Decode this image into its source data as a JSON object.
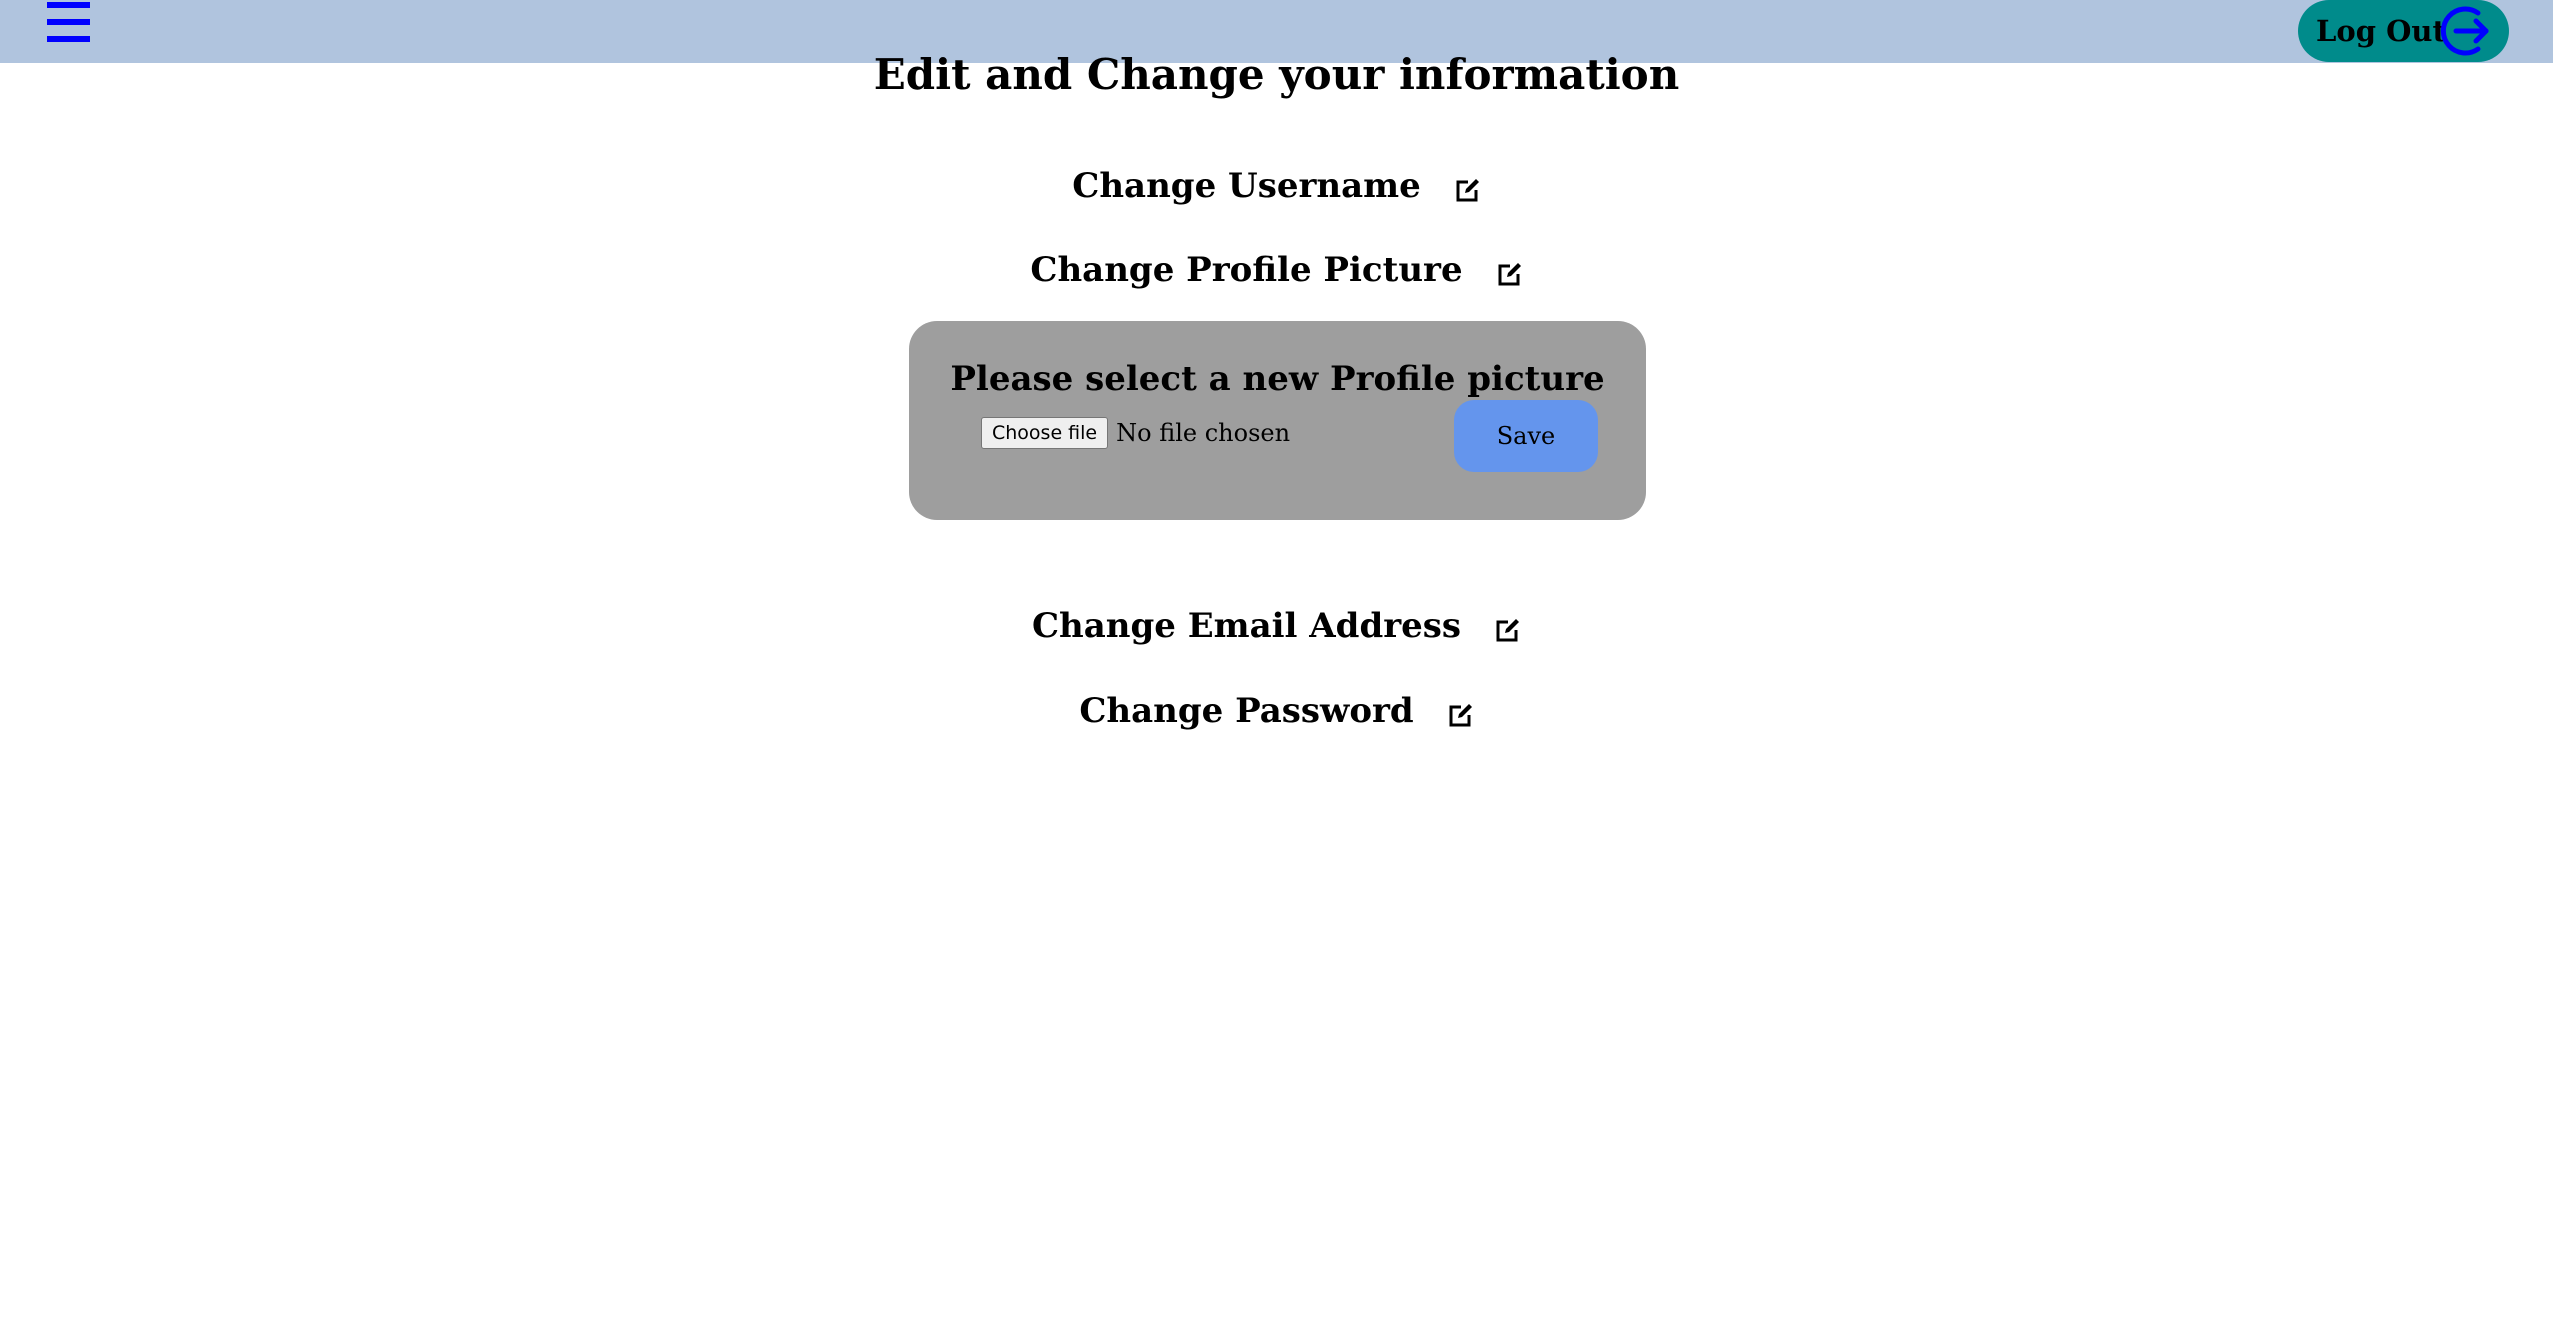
{
  "header": {
    "menu_icon": "hamburger-menu-icon",
    "logout_label": "Log Out",
    "logout_icon": "logout-arrow-icon",
    "bar_color": "#b0c4de",
    "logout_color": "#008b8b",
    "icon_color": "#0000ff"
  },
  "page": {
    "title": "Edit and Change your information"
  },
  "sections": {
    "username": "Change Username",
    "profile_picture": "Change Profile Picture",
    "email": "Change Email Address",
    "password": "Change Password",
    "edit_icon": "edit-pencil-icon"
  },
  "profile_panel": {
    "title": "Please select a new Profile picture",
    "choose_file_label": "Choose file",
    "file_status": "No file chosen",
    "save_label": "Save",
    "panel_color": "#9e9e9e",
    "save_color": "#6495ed"
  }
}
